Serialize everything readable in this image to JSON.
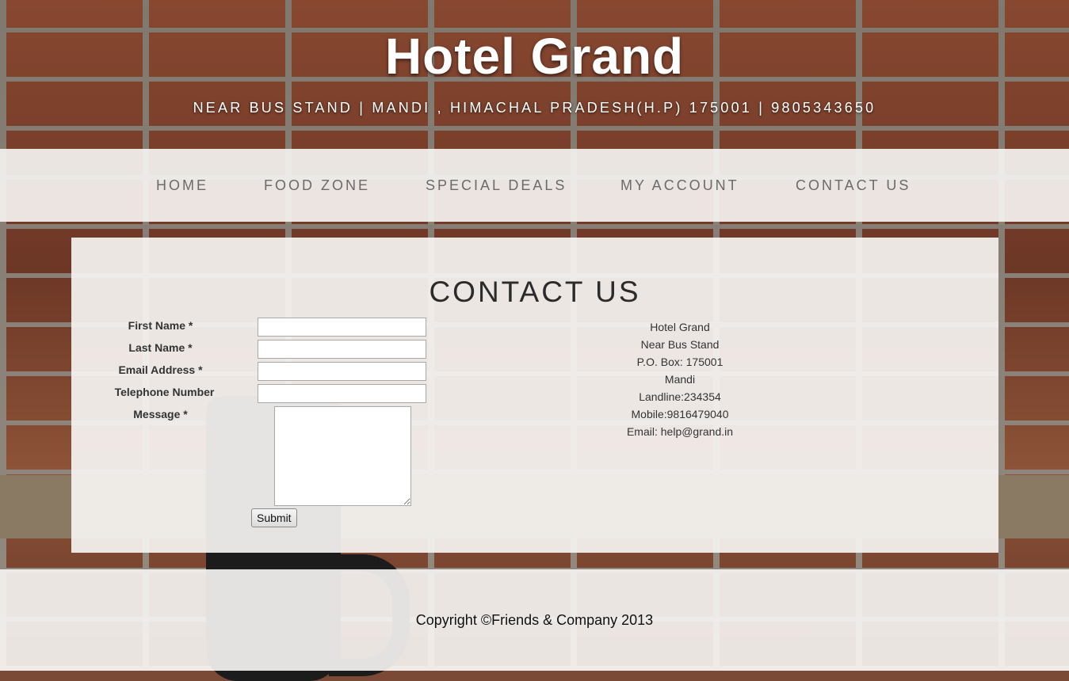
{
  "header": {
    "title": "Hotel Grand",
    "subtitle": "NEAR BUS STAND | MANDI , HIMACHAL PRADESH(H.P) 175001 | 9805343650"
  },
  "nav": {
    "items": [
      {
        "label": "HOME"
      },
      {
        "label": "FOOD ZONE"
      },
      {
        "label": "SPECIAL DEALS"
      },
      {
        "label": "MY ACCOUNT"
      },
      {
        "label": "CONTACT US"
      }
    ]
  },
  "contact": {
    "heading": "CONTACT US",
    "form": {
      "first_name_label": "First Name *",
      "first_name_value": "",
      "last_name_label": "Last Name *",
      "last_name_value": "",
      "email_label": "Email Address *",
      "email_value": "",
      "telephone_label": "Telephone Number",
      "telephone_value": "",
      "message_label": "Message *",
      "message_value": "",
      "submit_label": "Submit"
    },
    "address": {
      "line1": "Hotel Grand",
      "line2": "Near Bus Stand",
      "line3": "P.O. Box: 175001",
      "line4": "Mandi",
      "line5": "Landline:234354",
      "line6": "Mobile:9816479040",
      "line7": "Email: help@grand.in"
    }
  },
  "footer": {
    "copyright": "Copyright ©Friends & Company 2013"
  },
  "colors": {
    "nav_text": "#6b6b6b",
    "panel_bg": "#f5f3f1",
    "title_text": "#ffffff"
  }
}
